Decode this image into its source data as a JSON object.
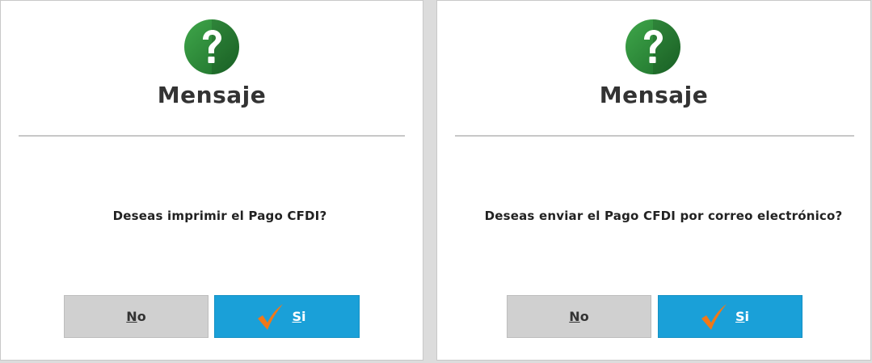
{
  "dialogs": [
    {
      "title": "Mensaje",
      "icon": "question-icon",
      "message": "Deseas imprimir el Pago CFDI?",
      "buttons": {
        "no": {
          "mnemonic": "N",
          "rest": "o"
        },
        "yes": {
          "mnemonic": "S",
          "rest": "i",
          "icon": "checkmark-icon"
        }
      }
    },
    {
      "title": "Mensaje",
      "icon": "question-icon",
      "message": "Deseas enviar el Pago CFDI por correo electrónico?",
      "buttons": {
        "no": {
          "mnemonic": "N",
          "rest": "o"
        },
        "yes": {
          "mnemonic": "S",
          "rest": "i",
          "icon": "checkmark-icon"
        }
      }
    }
  ],
  "colors": {
    "icon_green": "#2e8b3a",
    "yes_button": "#1aa0d8",
    "no_button": "#d0d0d0",
    "checkmark": "#f07818"
  }
}
